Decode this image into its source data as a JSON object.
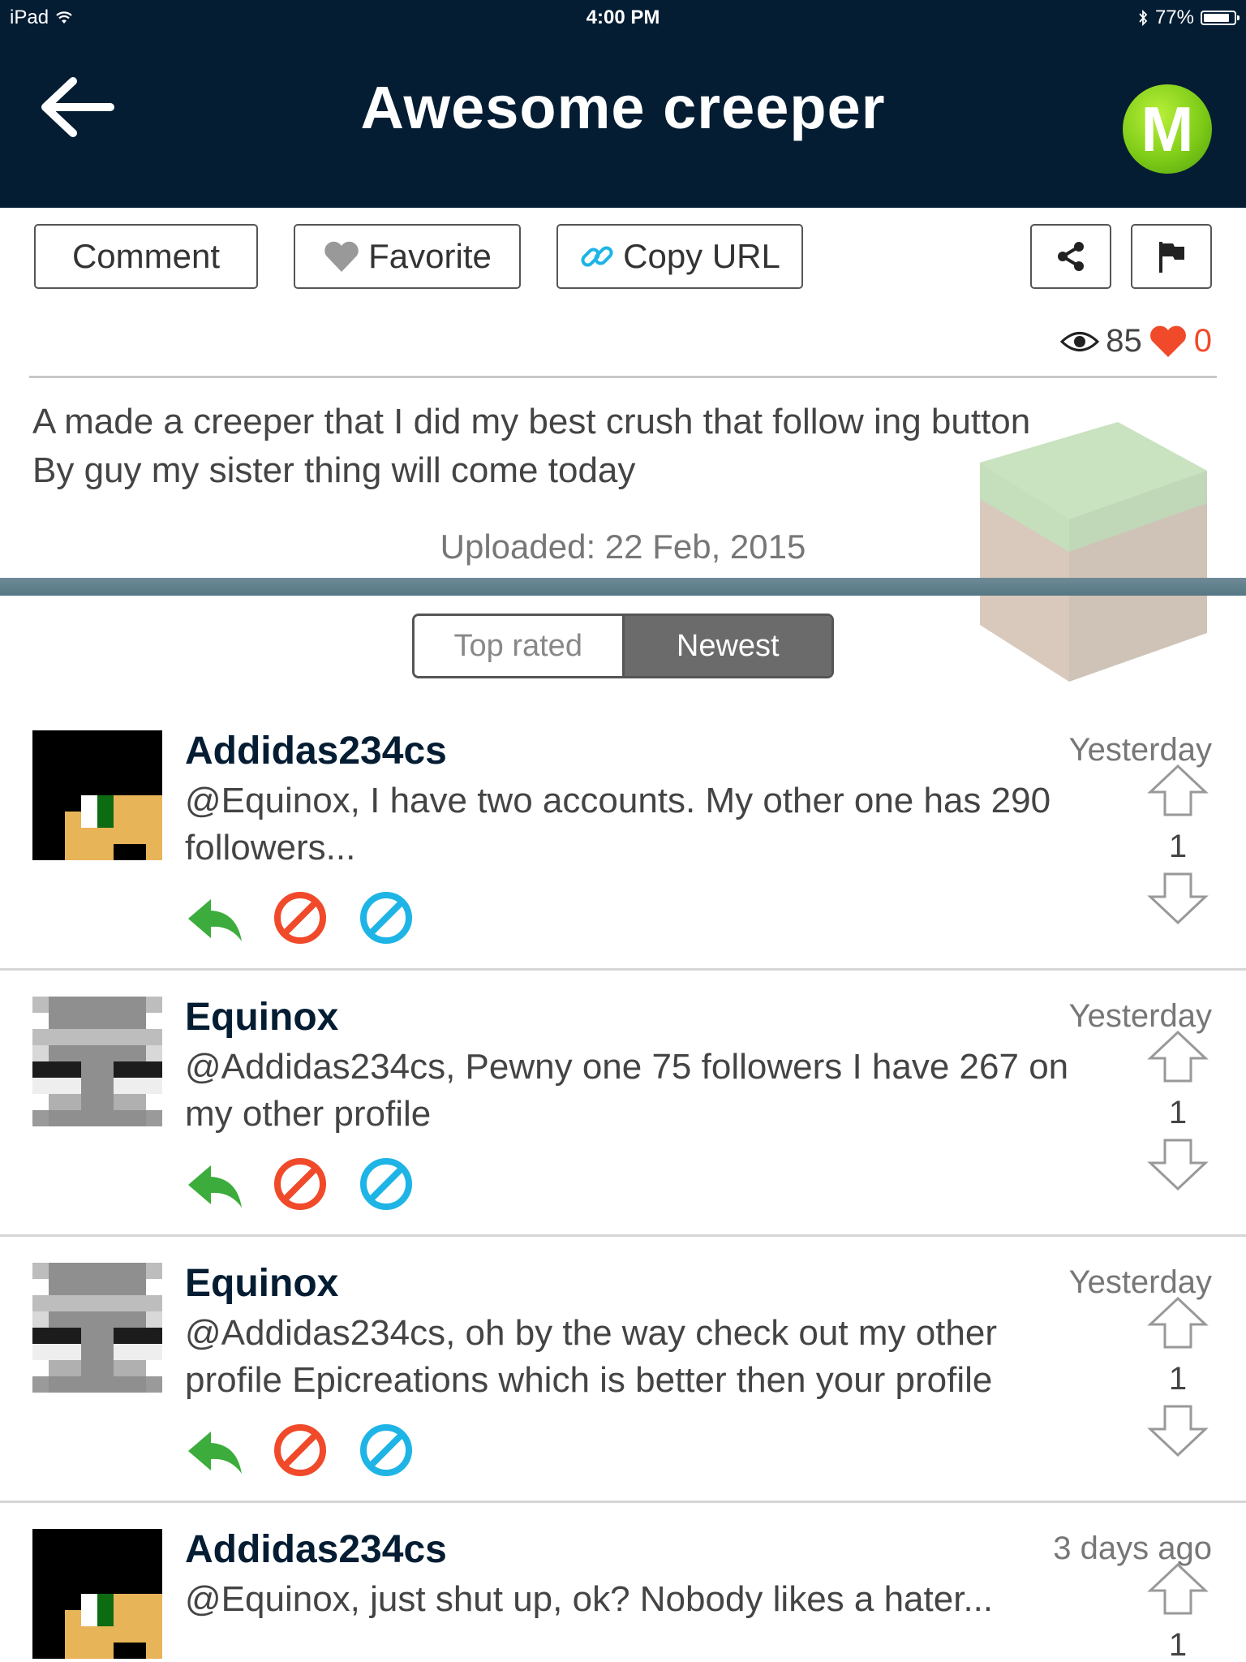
{
  "status_bar": {
    "device": "iPad",
    "time": "4:00 PM",
    "battery": "77%"
  },
  "nav": {
    "title": "Awesome creeper",
    "logo_letter": "M"
  },
  "toolbar": {
    "comment": "Comment",
    "favorite": "Favorite",
    "copy_url": "Copy URL"
  },
  "stats": {
    "views": "85",
    "likes": "0"
  },
  "post": {
    "description_line1": "A made a creeper that I did my best crush that follow ing button",
    "description_line2": "By guy my sister thing will come today",
    "uploaded": "Uploaded: 22 Feb, 2015"
  },
  "sort_tabs": [
    {
      "label": "Top rated",
      "selected": false
    },
    {
      "label": "Newest",
      "selected": true
    }
  ],
  "comments": [
    {
      "author": "Addidas234cs",
      "time": "Yesterday",
      "text": "@Equinox, I have two accounts. My other one has 290 followers...",
      "votes": "1",
      "avatar": "skin-avatar"
    },
    {
      "author": "Equinox",
      "time": "Yesterday",
      "text": "@Addidas234cs, Pewny one 75 followers I have 267 on my other profile",
      "votes": "1",
      "avatar": "creeper-avatar"
    },
    {
      "author": "Equinox",
      "time": "Yesterday",
      "text": "@Addidas234cs, oh by the way check out my other profile Epicreations which is better then your profile",
      "votes": "1",
      "avatar": "creeper-avatar"
    },
    {
      "author": "Addidas234cs",
      "time": "3 days ago",
      "text": "@Equinox, just shut up, ok? Nobody likes a hater...",
      "votes": "1",
      "avatar": "skin-avatar"
    }
  ],
  "colors": {
    "nav_bg": "#041d33",
    "reply": "#3cac3c",
    "block": "#f04a2a",
    "moderate": "#1eb4e6",
    "like_heart": "#f04a2a",
    "logo_green": "#7fcc18"
  },
  "icons": [
    "back-arrow-icon",
    "heart-icon",
    "link-icon",
    "share-icon",
    "flag-icon",
    "eye-icon",
    "reply-icon",
    "block-icon",
    "moderate-icon",
    "upvote-icon",
    "downvote-icon"
  ]
}
